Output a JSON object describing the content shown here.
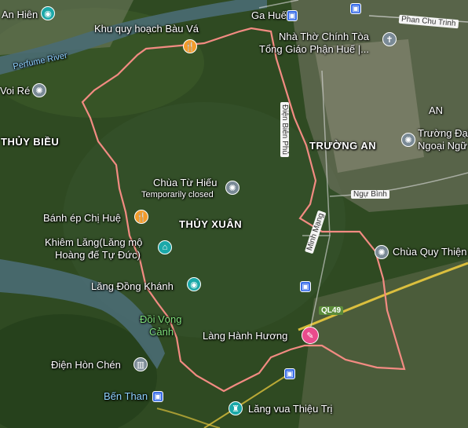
{
  "map": {
    "labels": {
      "an_hien": "An Hiên",
      "perfume_river": "Perfume River",
      "voi_re": "Voi Ré",
      "thuy_bieu": "THỦY BIỀU",
      "khu_quy_hoach": "Khu quy hoạch Bàu Vá",
      "ga_hue": "Ga Huế",
      "phan_chu_trinh": "Phan Chu Trinh",
      "nha_tho_line1": "Nhà Thờ Chính Tòa",
      "nha_tho_line2": "Tổng Giáo Phận Huế |...",
      "dien_bien_phu": "Điện Biên Phủ",
      "truong_an": "TRƯỜNG AN",
      "truong_dai_line1": "Trường Đại",
      "truong_dai_line2": "Ngoại Ngữ",
      "an_edge": "AN",
      "chua_tu_hieu": "Chùa Từ Hiếu",
      "temporarily_closed": "Temporarily closed",
      "ngu_binh": "Ngự Bình",
      "banh_ep": "Bánh ép Chị Huệ",
      "thuy_xuan": "THỦY XUÂN",
      "khiem_lang_line1": "Khiêm Lăng(Lăng mộ",
      "khiem_lang_line2": "Hoàng đế Tự Đức)",
      "minh_mang": "Minh Mạng",
      "chua_quy_thien": "Chùa Quy Thiện",
      "lang_dong_khanh": "Lăng Đồng Khánh",
      "ql49": "QL49",
      "doi_vong_canh_line1": "Đồi Vọng",
      "doi_vong_canh_line2": "Cảnh",
      "lang_huong": "Làng Hành Hương",
      "dien_hon_chen": "Điện Hòn Chén",
      "ben_than": "Bến Than",
      "lang_vua": "Lăng vua Thiệu Trị"
    },
    "icons": {
      "camera": "camera-icon",
      "food": "fork-knife-icon",
      "religious": "dharma-wheel-icon",
      "church": "cross-icon",
      "transit": "bus-icon",
      "museum": "museum-icon",
      "shopping": "shopping-icon",
      "monument": "monument-icon"
    },
    "colors": {
      "boundary": "#f28b82",
      "river": "#4a6b73",
      "road": "#f4d03f",
      "pin_gray": "#7a8a96",
      "pin_orange": "#f29b2a",
      "pin_pink": "#e94b8c",
      "pin_teal": "#1ba8a8",
      "transit_blue": "#3a6ee8"
    }
  }
}
